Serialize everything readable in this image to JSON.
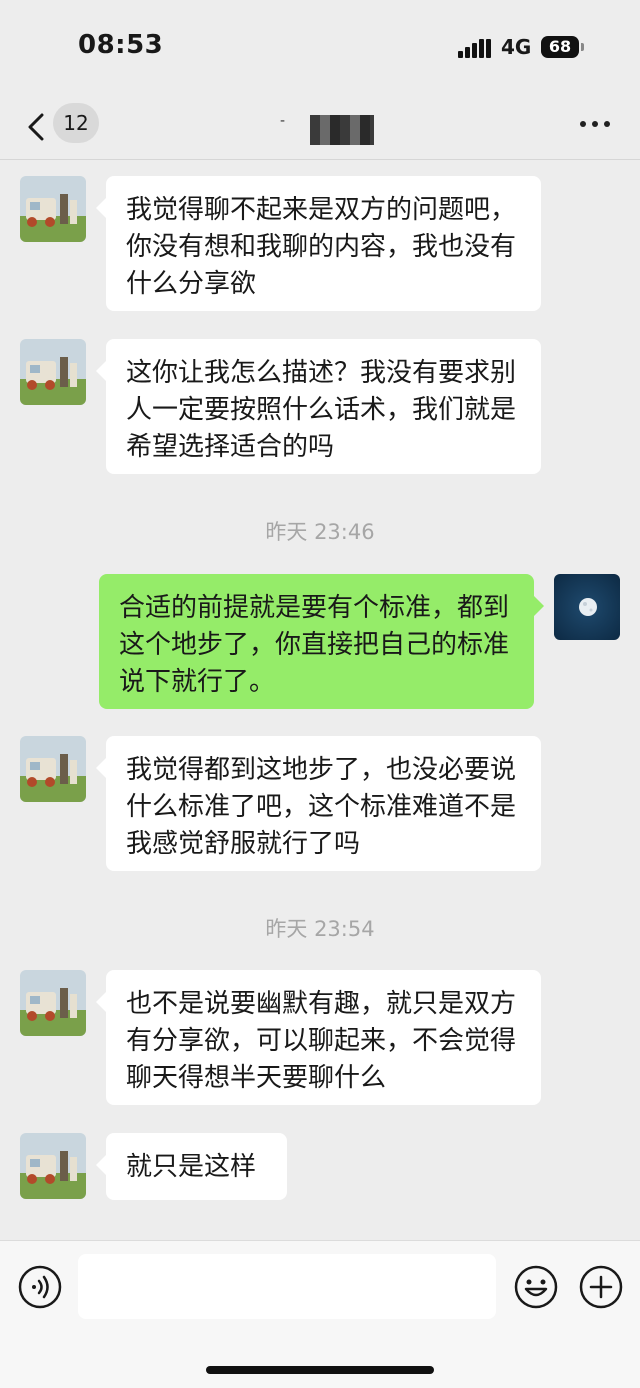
{
  "status_bar": {
    "time": "08:53",
    "network": "4G",
    "battery": "68"
  },
  "nav": {
    "back_count": "12",
    "title_prefix": "-"
  },
  "messages": [
    {
      "side": "in",
      "text": "我觉得聊不起来是双方的问题吧，你没有想和我聊的内容，我也没有什么分享欲"
    },
    {
      "side": "in",
      "text": "这你让我怎么描述？我没有要求别人一定要按照什么话术，我们就是希望选择适合的吗"
    },
    {
      "timestamp": "昨天 23:46"
    },
    {
      "side": "out",
      "text": "合适的前提就是要有个标准，都到这个地步了，你直接把自己的标准说下就行了。"
    },
    {
      "side": "in",
      "text": "我觉得都到这地步了，也没必要说什么标准了吧，这个标准难道不是我感觉舒服就行了吗"
    },
    {
      "timestamp": "昨天 23:54"
    },
    {
      "side": "in",
      "text": "也不是说要幽默有趣，就只是双方有分享欲，可以聊起来，不会觉得聊天得想半天要聊什么"
    },
    {
      "side": "in",
      "text": "就只是这样"
    }
  ],
  "colors": {
    "background": "#ededed",
    "bubble_in": "#ffffff",
    "bubble_out": "#95ec69"
  },
  "icons": [
    "back-chevron-icon",
    "more-dots-icon",
    "voice-icon",
    "emoji-icon",
    "plus-icon"
  ]
}
